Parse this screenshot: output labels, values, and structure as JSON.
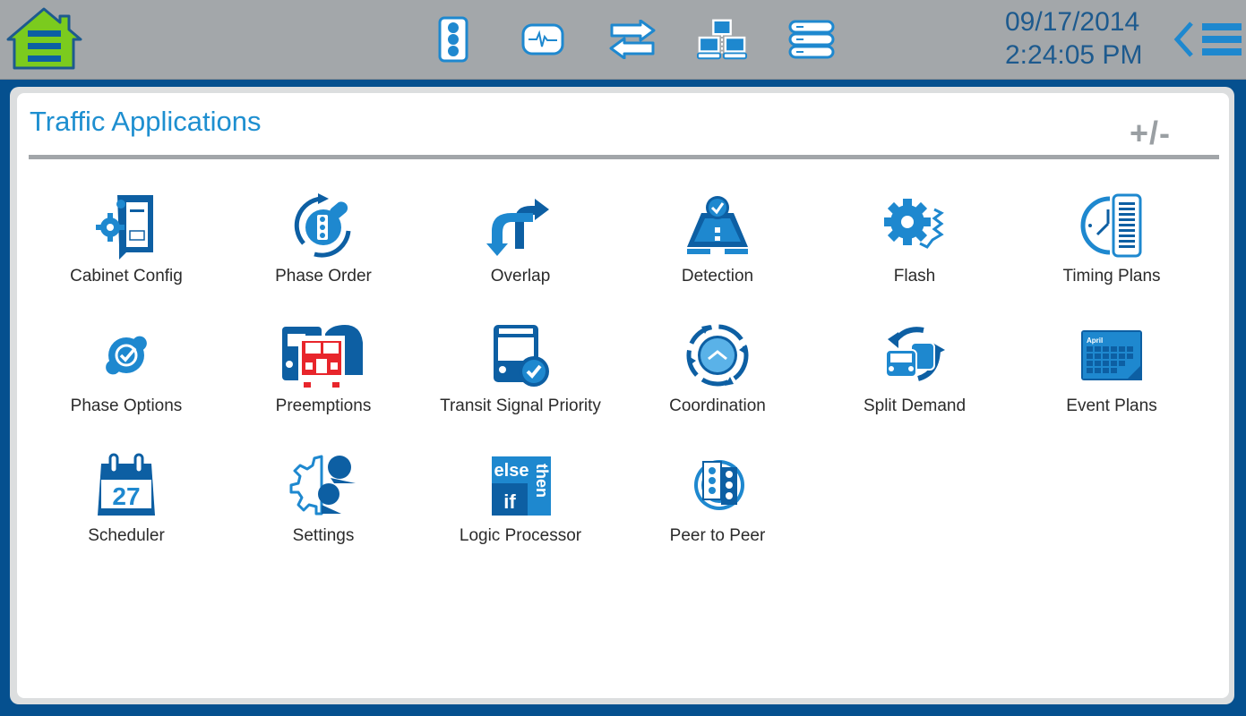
{
  "topbar": {
    "home_icon": "home-icon",
    "nav_icons": [
      "traffic-signal-icon",
      "monitor-waveform-icon",
      "transfer-arrows-icon",
      "network-icon",
      "server-stack-icon"
    ],
    "date": "09/17/2014",
    "time": "2:24:05 PM",
    "back_icon": "chevron-left-icon",
    "menu_icon": "hamburger-menu-icon"
  },
  "panel": {
    "title": "Traffic Applications",
    "toggle_label": "+/-"
  },
  "apps": [
    {
      "label": "Cabinet Config",
      "icon": "cabinet-config-icon"
    },
    {
      "label": "Phase Order",
      "icon": "phase-order-icon"
    },
    {
      "label": "Overlap",
      "icon": "overlap-icon"
    },
    {
      "label": "Detection",
      "icon": "detection-icon"
    },
    {
      "label": "Flash",
      "icon": "flash-icon"
    },
    {
      "label": "Timing Plans",
      "icon": "timing-plans-icon"
    },
    {
      "label": "Phase Options",
      "icon": "phase-options-icon"
    },
    {
      "label": "Preemptions",
      "icon": "preemptions-icon"
    },
    {
      "label": "Transit Signal Priority",
      "icon": "transit-signal-priority-icon"
    },
    {
      "label": "Coordination",
      "icon": "coordination-icon"
    },
    {
      "label": "Split Demand",
      "icon": "split-demand-icon"
    },
    {
      "label": "Event Plans",
      "icon": "event-plans-icon"
    },
    {
      "label": "Scheduler",
      "icon": "scheduler-icon"
    },
    {
      "label": "Settings",
      "icon": "settings-icon"
    },
    {
      "label": "Logic Processor",
      "icon": "logic-processor-icon"
    },
    {
      "label": "Peer to Peer",
      "icon": "peer-to-peer-icon"
    }
  ],
  "icon_text": {
    "event_month": "April",
    "scheduler_day": "27",
    "logic_else": "else",
    "logic_if": "if",
    "logic_then": "then"
  },
  "colors": {
    "frame": "#05508f",
    "topbar": "#a3a7aa",
    "title": "#1e8fd0",
    "icon_dark": "#0d5fa3",
    "icon_light": "#1e88cf",
    "home_green": "#7bcb1e",
    "preempt_red": "#e8252b"
  }
}
